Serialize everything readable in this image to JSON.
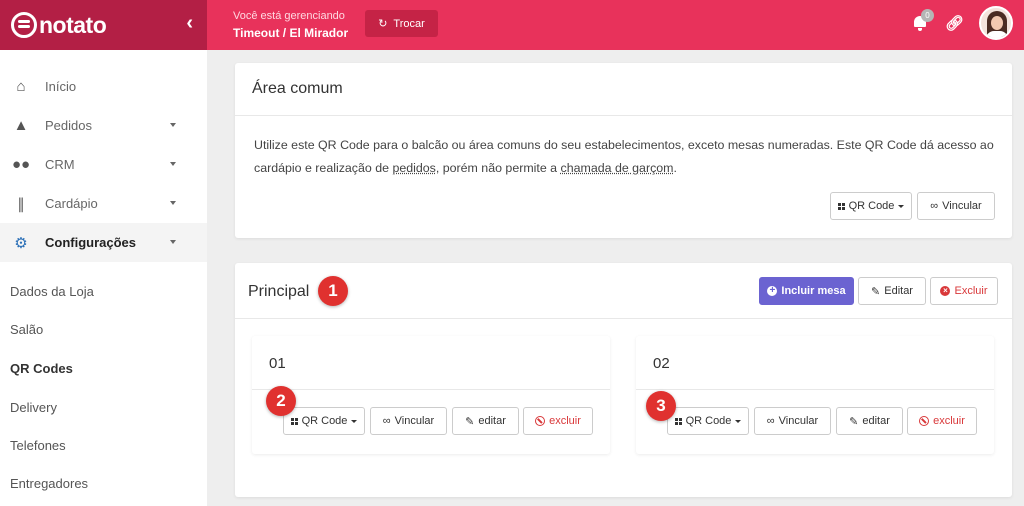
{
  "brand": {
    "name": "notato",
    "collapse_icon": "chevron-left-icon"
  },
  "topbar": {
    "managing_label": "Você está gerenciando",
    "store_name": "Timeout / El Mirador",
    "swap_button": "Trocar",
    "notifications_count": "0"
  },
  "sidebar": {
    "items": [
      {
        "label": "Início",
        "icon": "home-icon"
      },
      {
        "label": "Pedidos",
        "icon": "bell-icon"
      },
      {
        "label": "CRM",
        "icon": "users-icon"
      },
      {
        "label": "Cardápio",
        "icon": "utensils-icon"
      },
      {
        "label": "Configurações",
        "icon": "gear-icon"
      }
    ],
    "subitems": [
      "Dados da Loja",
      "Salão",
      "QR Codes",
      "Delivery",
      "Telefones",
      "Entregadores"
    ]
  },
  "area_comum": {
    "title": "Área comum",
    "desc_1": "Utilize este QR Code para o balcão ou área comuns do seu estabelecimentos, exceto mesas numeradas. Este QR Code dá acesso ao cardápio e realização de ",
    "desc_link_1": "pedidos",
    "desc_2": ", porém não permite a ",
    "desc_link_2": "chamada de garçom",
    "desc_3": ".",
    "qr_button": "QR Code",
    "link_button": "Vincular"
  },
  "principal": {
    "title": "Principal",
    "add_button": "Incluir mesa",
    "edit_button": "Editar",
    "delete_button": "Excluir",
    "tables": [
      {
        "number": "01",
        "qr": "QR Code",
        "link": "Vincular",
        "edit": "editar",
        "delete": "excluir"
      },
      {
        "number": "02",
        "qr": "QR Code",
        "link": "Vincular",
        "edit": "editar",
        "delete": "excluir"
      }
    ]
  },
  "annotations": [
    "1",
    "2",
    "3"
  ],
  "colors": {
    "brand_dark": "#b31f45",
    "topbar": "#e8325b",
    "primary": "#6b63d1",
    "danger": "#d9383a",
    "marker": "#e0312f"
  }
}
